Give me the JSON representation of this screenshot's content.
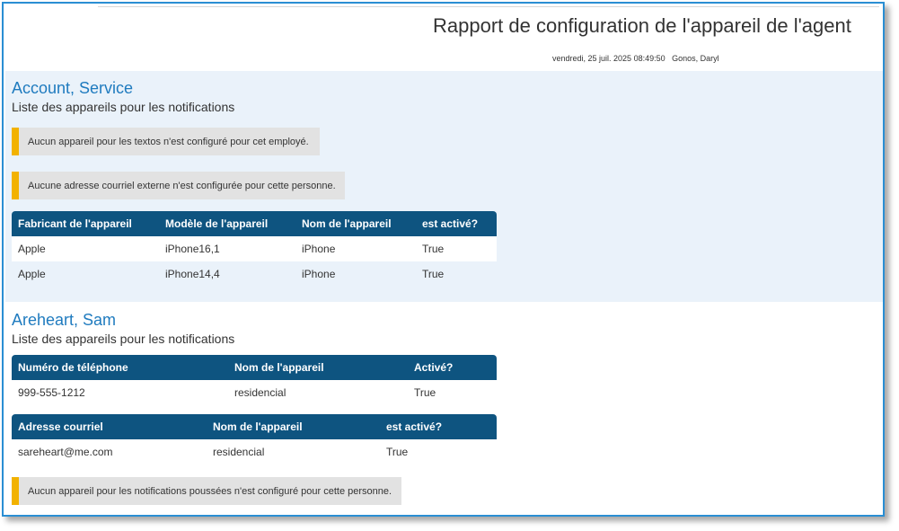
{
  "report": {
    "title": "Rapport de configuration de l'appareil de l'agent",
    "date": "vendredi, 25 juil. 2025 08:49:50",
    "user": "Gonos, Daryl"
  },
  "sections": [
    {
      "name": "Account, Service",
      "subtitle": "Liste des appareils pour les notifications",
      "notices": [
        "Aucun appareil pour les textos n'est configuré pour cet employé.",
        "Aucune adresse courriel externe n'est configurée pour cette personne."
      ],
      "device_table": {
        "headers": [
          "Fabricant de l'appareil",
          "Modèle de l'appareil",
          "Nom de l'appareil",
          "est activé?"
        ],
        "rows": [
          [
            "Apple",
            "iPhone16,1",
            "iPhone",
            "True"
          ],
          [
            "Apple",
            "iPhone14,4",
            "iPhone",
            "True"
          ]
        ]
      }
    },
    {
      "name": "Areheart, Sam",
      "subtitle": "Liste des appareils pour les notifications",
      "phone_table": {
        "headers": [
          "Numéro de téléphone",
          "Nom de l'appareil",
          "Activé?"
        ],
        "rows": [
          [
            "999-555-1212",
            "residencial",
            "True"
          ]
        ]
      },
      "email_table": {
        "headers": [
          "Adresse courriel",
          "Nom de l'appareil",
          "est activé?"
        ],
        "rows": [
          [
            "sareheart@me.com",
            "residencial",
            "True"
          ]
        ]
      },
      "notices": [
        "Aucun appareil pour les notifications poussées n'est configuré pour cette personne."
      ]
    }
  ],
  "colors": {
    "accent": "#1f7bbf",
    "header_bg": "#0e5480",
    "notice_bar": "#f2b200",
    "section_bg": "#eaf2fa"
  }
}
